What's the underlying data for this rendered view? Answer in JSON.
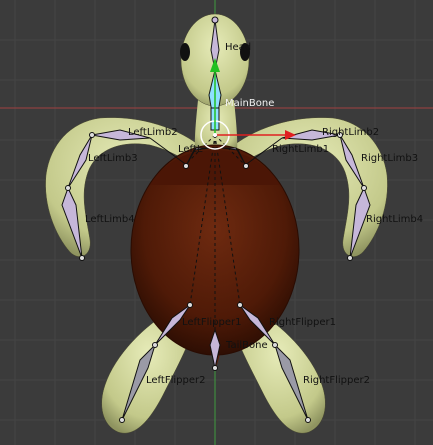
{
  "viewport": {
    "background": "#3b3b3b",
    "grid_color": "#444444",
    "x_axis_color": "#b34444",
    "y_axis_color": "#3f9b3f"
  },
  "armature": {
    "bone_fill": "#c6b7d9",
    "bone_stroke": "#1a1a1a",
    "selected_bone_fill": "#6ad6ff",
    "labels": {
      "head": "Head",
      "main_bone": "MainBone",
      "left_limb1": "LeftL",
      "left_limb2": "LeftLimb2",
      "left_limb3": "LeftLimb3",
      "left_limb4": "LeftLimb4",
      "right_limb1": "RightLimb1",
      "right_limb2": "RightLimb2",
      "right_limb3": "RightLimb3",
      "right_limb4": "RightLimb4",
      "left_flipper1": "LeftFlipper1",
      "left_flipper2": "LeftFlipper2",
      "right_flipper1": "RightFlipper1",
      "right_flipper2": "RightFlipper2",
      "tail_bone": "TailBone"
    }
  },
  "mesh": {
    "skin_color": "#cdd39a",
    "shell_color": "#5a1e0a",
    "eye_color": "#111111"
  },
  "gizmo": {
    "x_arrow_color": "#e02020",
    "y_arrow_color": "#20c020",
    "ring_color": "#ffffff"
  }
}
